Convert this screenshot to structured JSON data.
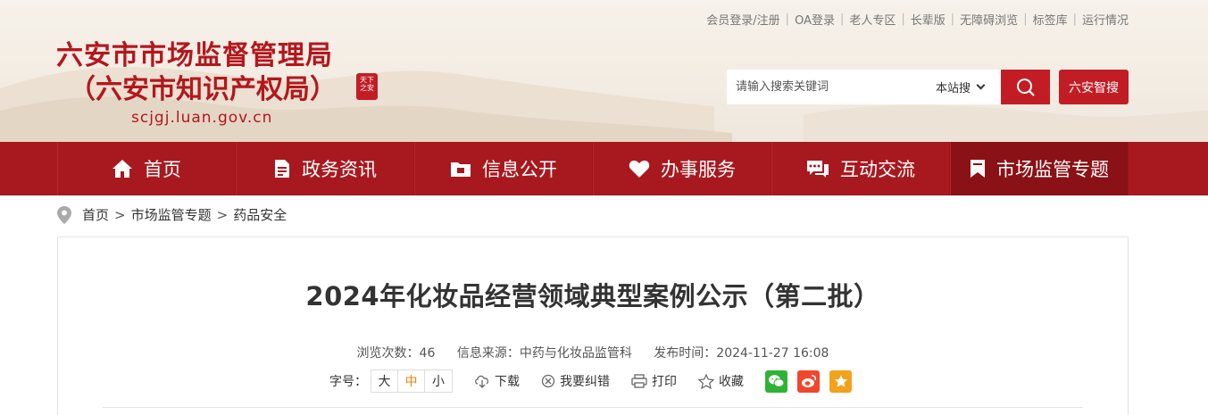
{
  "top_links": [
    "会员登录/注册",
    "OA登录",
    "老人专区",
    "长辈版",
    "无障碍浏览",
    "标签库",
    "运行情况"
  ],
  "logo": {
    "line1": "六安市市场监督管理局",
    "line2": "（六安市知识产权局）",
    "domain": "scjgj.luan.gov.cn",
    "seal_text": "天下之安"
  },
  "search": {
    "placeholder": "请输入搜索关键词",
    "scope": "本站搜",
    "button_icon": "search-icon",
    "zhisou": "六安智搜"
  },
  "nav": [
    {
      "label": "首页",
      "icon": "home-icon"
    },
    {
      "label": "政务资讯",
      "icon": "document-icon"
    },
    {
      "label": "信息公开",
      "icon": "folder-icon"
    },
    {
      "label": "办事服务",
      "icon": "heart-icon"
    },
    {
      "label": "互动交流",
      "icon": "chat-icon"
    },
    {
      "label": "市场监管专题",
      "icon": "bookmark-icon"
    }
  ],
  "breadcrumb": [
    "首页",
    "市场监管专题",
    "药品安全"
  ],
  "article": {
    "title": "2024年化妆品经营领域典型案例公示（第二批）",
    "views_label": "浏览次数：",
    "views": "46",
    "source_label": "信息来源：",
    "source": "中药与化妆品监管科",
    "time_label": "发布时间：",
    "time": "2024-11-27 16:08",
    "font_label": "字号：",
    "font_sizes": [
      "大",
      "中",
      "小"
    ],
    "tools": [
      "下载",
      "我要纠错",
      "打印",
      "收藏"
    ]
  },
  "colors": {
    "brand": "#a8191f",
    "accent": "#c21d25",
    "wechat": "#30b335",
    "weibo": "#f0472d",
    "qzone": "#f2a21d"
  }
}
